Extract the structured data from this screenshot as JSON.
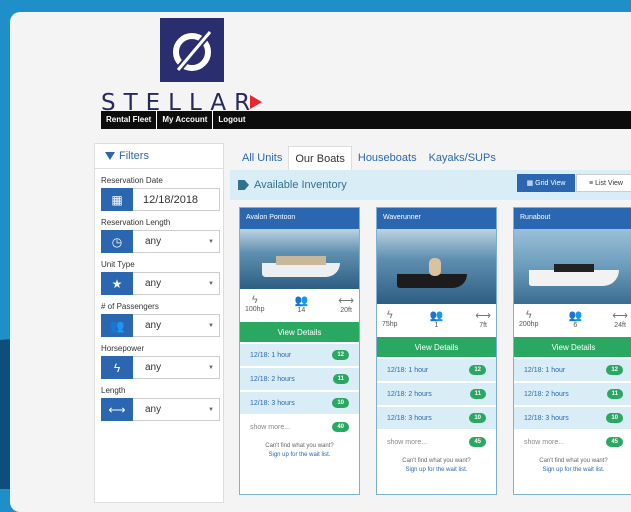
{
  "brand": {
    "name": "STELLAR"
  },
  "nav": [
    "Rental Fleet",
    "My Account",
    "Logout"
  ],
  "filters": {
    "title": "Filters",
    "groups": [
      {
        "label": "Reservation Date",
        "value": "12/18/2018",
        "icon": "calendar-icon"
      },
      {
        "label": "Reservation Length",
        "value": "any",
        "icon": "clock-icon"
      },
      {
        "label": "Unit Type",
        "value": "any",
        "icon": "star-icon"
      },
      {
        "label": "# of Passengers",
        "value": "any",
        "icon": "users-icon"
      },
      {
        "label": "Horsepower",
        "value": "any",
        "icon": "bolt-icon"
      },
      {
        "label": "Length",
        "value": "any",
        "icon": "arrows-icon"
      }
    ]
  },
  "tabs": [
    "All Units",
    "Our Boats",
    "Houseboats",
    "Kayaks/SUPs"
  ],
  "inventory": {
    "title": "Available Inventory",
    "grid_view": "Grid View",
    "list_view": "List View"
  },
  "boats": [
    {
      "name": "Avalon Pontoon",
      "hp": "100hp",
      "passengers": "14",
      "length": "20ft",
      "details": "View Details",
      "slots": [
        {
          "label": "12/18: 1 hour",
          "count": "12"
        },
        {
          "label": "12/18: 2 hours",
          "count": "11"
        },
        {
          "label": "12/18: 3 hours",
          "count": "10"
        }
      ],
      "more": "show more...",
      "more_count": "40"
    },
    {
      "name": "Waverunner",
      "hp": "75hp",
      "passengers": "1",
      "length": "7ft",
      "details": "View Details",
      "slots": [
        {
          "label": "12/18: 1 hour",
          "count": "12"
        },
        {
          "label": "12/18: 2 hours",
          "count": "11"
        },
        {
          "label": "12/18: 3 hours",
          "count": "10"
        }
      ],
      "more": "show more...",
      "more_count": "45"
    },
    {
      "name": "Runabout",
      "hp": "200hp",
      "passengers": "6",
      "length": "24ft",
      "details": "View Details",
      "slots": [
        {
          "label": "12/18: 1 hour",
          "count": "12"
        },
        {
          "label": "12/18: 2 hours",
          "count": "11"
        },
        {
          "label": "12/18: 3 hours",
          "count": "10"
        }
      ],
      "more": "show more...",
      "more_count": "45"
    }
  ],
  "waitlist": {
    "line1": "Can't find what you want?",
    "line2": "Sign up for the wait list."
  }
}
